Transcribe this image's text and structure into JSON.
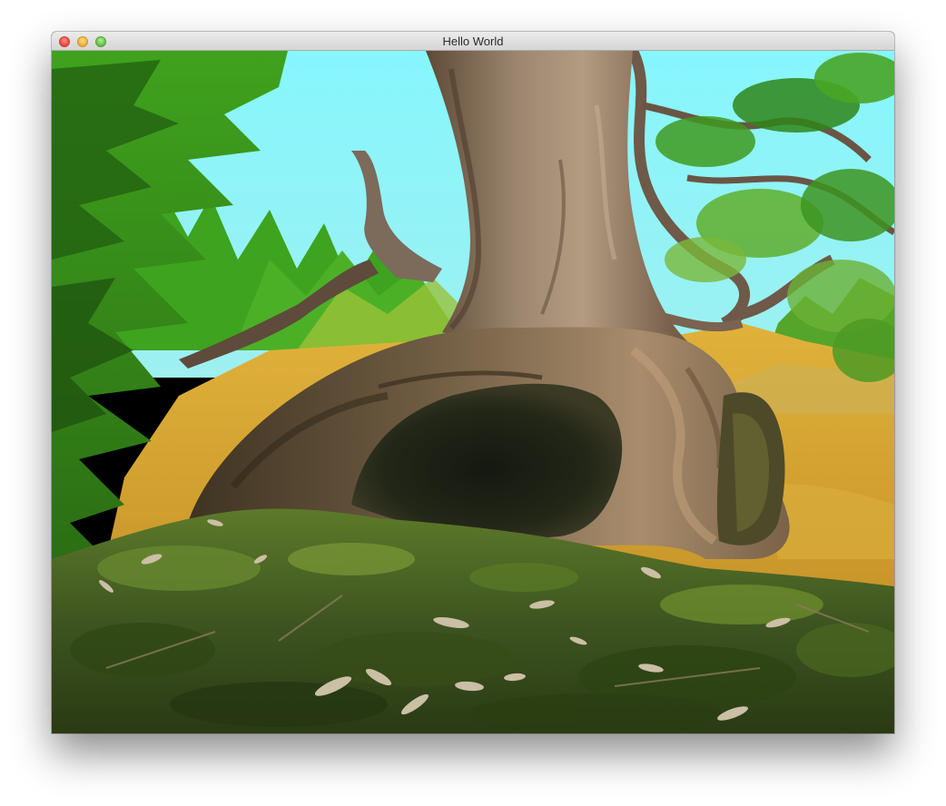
{
  "window": {
    "title": "Hello World"
  },
  "titlebar": {
    "buttons": [
      {
        "name": "close",
        "color": "#ee4b42"
      },
      {
        "name": "minimize",
        "color": "#f3b43a"
      },
      {
        "name": "zoom",
        "color": "#6cc34c"
      }
    ]
  },
  "photo": {
    "palette": {
      "sky": "#7df4fb",
      "grass": "#d3a52f",
      "moss": "#3f5a1c",
      "bark": "#8a7360",
      "foliage": "#3b8a1e"
    }
  }
}
